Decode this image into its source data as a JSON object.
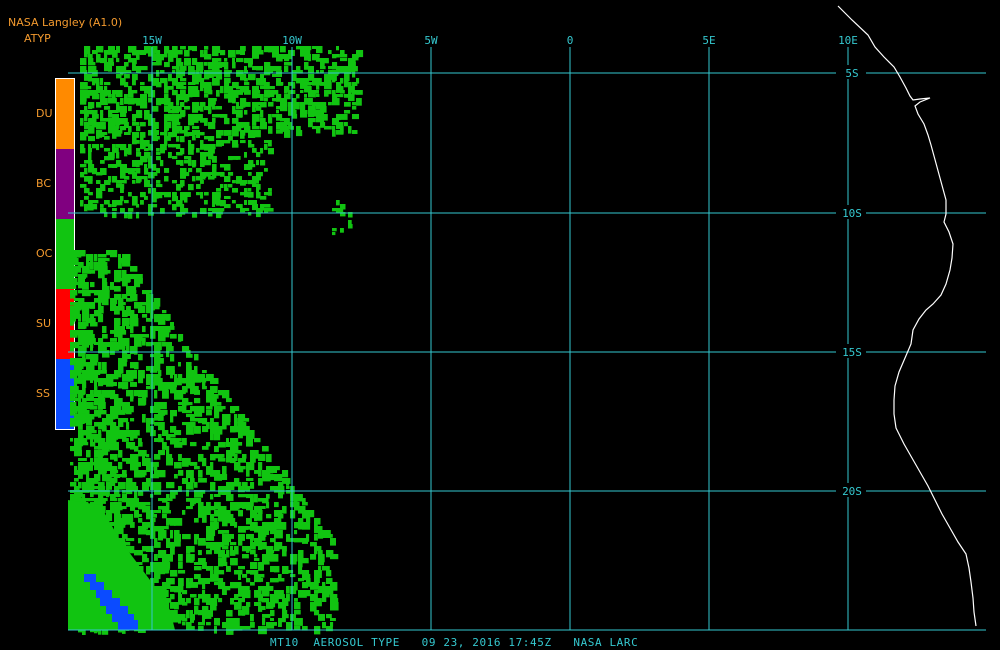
{
  "header": {
    "organization": "NASA Langley (A1.0)",
    "product_code": "ATYP"
  },
  "legend": {
    "items": [
      {
        "label": "DU",
        "color": "#ff8a00"
      },
      {
        "label": "BC",
        "color": "#800080"
      },
      {
        "label": "OC",
        "color": "#11c411"
      },
      {
        "label": "SU",
        "color": "#ff0000"
      },
      {
        "label": "SS",
        "color": "#0b4bff"
      }
    ]
  },
  "map": {
    "longitude_labels": [
      "15W",
      "10W",
      "5W",
      "0",
      "5E",
      "10E"
    ],
    "latitude_labels": [
      "5S",
      "10S",
      "15S",
      "20S"
    ],
    "grid_color": "#35c8cf",
    "coastline_color": "#ffffff",
    "aerosol_coverage": {
      "oc_color": "#11c411",
      "ss_color": "#0b4bff"
    }
  },
  "footer": {
    "text": "MT10  AEROSOL TYPE   09 23, 2016 17:45Z   NASA LARC"
  }
}
